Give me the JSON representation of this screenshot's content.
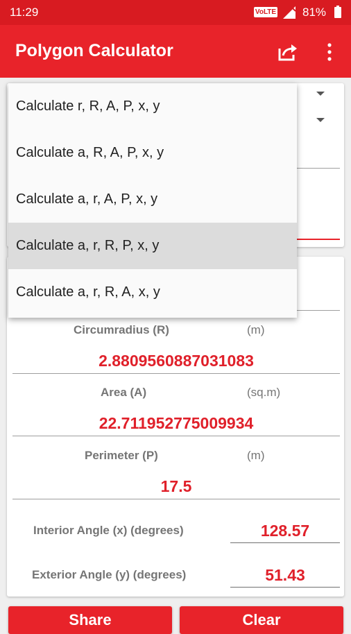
{
  "status_bar": {
    "time": "11:29",
    "network": "VoLTE",
    "battery": "81%"
  },
  "app_bar": {
    "title": "Polygon Calculator"
  },
  "dropdown": {
    "items": [
      "Calculate r, R, A, P, x, y",
      "Calculate a, R, A, P, x, y",
      "Calculate a, r, A, P, x, y",
      "Calculate a, r, R, P, x, y",
      "Calculate a, r, R, A, x, y"
    ],
    "highlighted_index": 3
  },
  "results": {
    "circumradius": {
      "label": "Circumradius (R)",
      "unit": "(m)",
      "value": "2.8809560887031083"
    },
    "area": {
      "label": "Area (A)",
      "unit": "(sq.m)",
      "value": "22.711952775009934"
    },
    "perimeter": {
      "label": "Perimeter (P)",
      "unit": "(m)",
      "value": "17.5"
    },
    "interior_angle": {
      "label": "Interior Angle (x) (degrees)",
      "value": "128.57"
    },
    "exterior_angle": {
      "label": "Exterior Angle (y) (degrees)",
      "value": "51.43"
    }
  },
  "buttons": {
    "share": "Share",
    "clear": "Clear"
  },
  "colors": {
    "primary": "#e8232a",
    "status_bar": "#d81b21",
    "value_text": "#e0202a"
  }
}
